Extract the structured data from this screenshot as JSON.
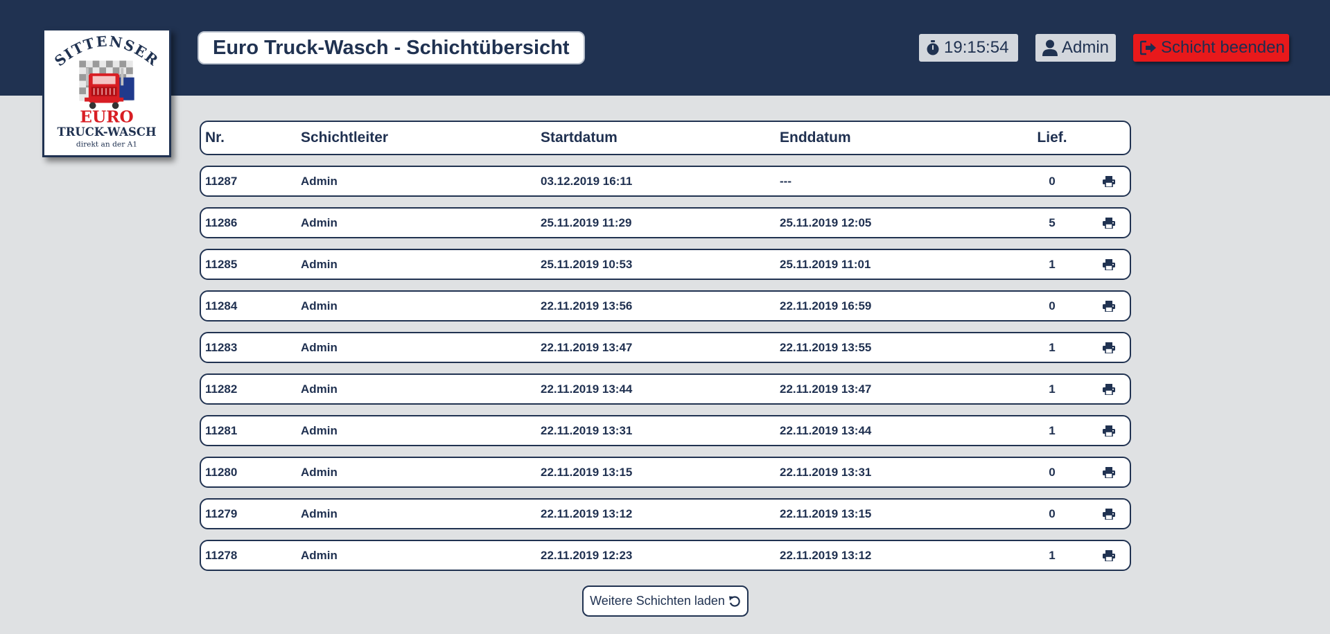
{
  "logo": {
    "top_text": "SITTENSER",
    "brand_line1": "EURO",
    "brand_line2": "TRUCK-WASCH",
    "tagline": "direkt an der A1"
  },
  "header": {
    "title": "Euro Truck-Wasch - Schichtübersicht",
    "timer": "19:15:54",
    "user": "Admin",
    "end_shift": "Schicht beenden"
  },
  "table": {
    "columns": [
      "Nr.",
      "Schichtleiter",
      "Startdatum",
      "Enddatum",
      "Lief."
    ],
    "rows": [
      {
        "nr": "11287",
        "leiter": "Admin",
        "start": "03.12.2019 16:11",
        "end": "---",
        "lief": "0"
      },
      {
        "nr": "11286",
        "leiter": "Admin",
        "start": "25.11.2019 11:29",
        "end": "25.11.2019 12:05",
        "lief": "5"
      },
      {
        "nr": "11285",
        "leiter": "Admin",
        "start": "25.11.2019 10:53",
        "end": "25.11.2019 11:01",
        "lief": "1"
      },
      {
        "nr": "11284",
        "leiter": "Admin",
        "start": "22.11.2019 13:56",
        "end": "22.11.2019 16:59",
        "lief": "0"
      },
      {
        "nr": "11283",
        "leiter": "Admin",
        "start": "22.11.2019 13:47",
        "end": "22.11.2019 13:55",
        "lief": "1"
      },
      {
        "nr": "11282",
        "leiter": "Admin",
        "start": "22.11.2019 13:44",
        "end": "22.11.2019 13:47",
        "lief": "1"
      },
      {
        "nr": "11281",
        "leiter": "Admin",
        "start": "22.11.2019 13:31",
        "end": "22.11.2019 13:44",
        "lief": "1"
      },
      {
        "nr": "11280",
        "leiter": "Admin",
        "start": "22.11.2019 13:15",
        "end": "22.11.2019 13:31",
        "lief": "0"
      },
      {
        "nr": "11279",
        "leiter": "Admin",
        "start": "22.11.2019 13:12",
        "end": "22.11.2019 13:15",
        "lief": "0"
      },
      {
        "nr": "11278",
        "leiter": "Admin",
        "start": "22.11.2019 12:23",
        "end": "22.11.2019 13:12",
        "lief": "1"
      }
    ]
  },
  "load_more": "Weitere Schichten laden",
  "colors": {
    "header_bg": "#203251",
    "page_bg": "#dfe1e3",
    "accent_red": "#e8191b",
    "chip_bg": "#d3d7dd"
  },
  "icons": {
    "timer": "stopwatch-icon",
    "user": "user-icon",
    "end_shift": "sign-out-icon",
    "print": "print-icon",
    "reload": "undo-icon"
  }
}
